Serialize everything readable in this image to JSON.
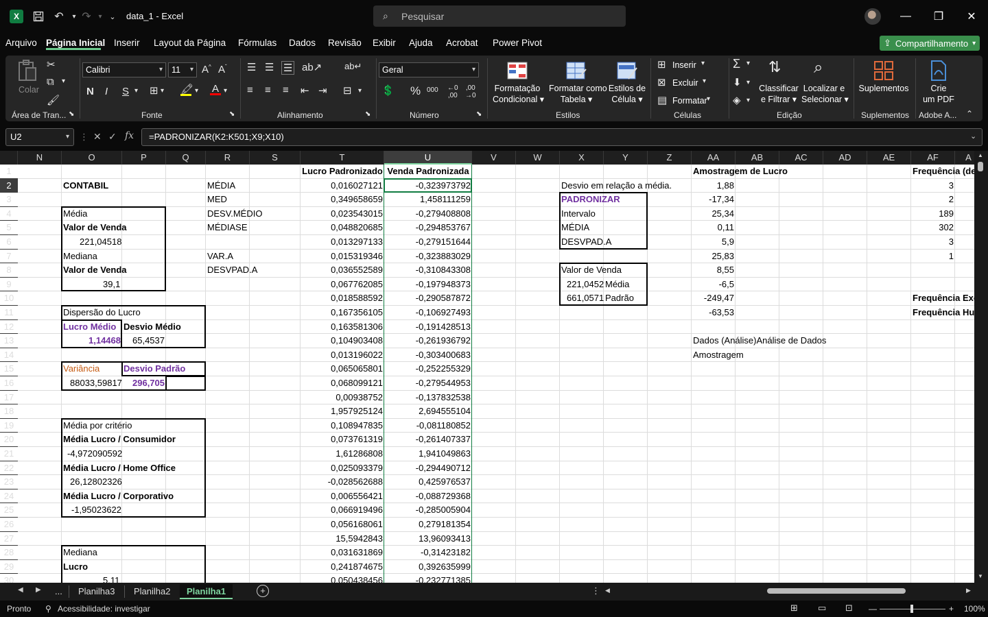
{
  "window": {
    "title": "data_1  -  Excel",
    "search_placeholder": "Pesquisar"
  },
  "menu": {
    "items": [
      "Arquivo",
      "Página Inicial",
      "Inserir",
      "Layout da Página",
      "Fórmulas",
      "Dados",
      "Revisão",
      "Exibir",
      "Ajuda",
      "Acrobat",
      "Power Pivot"
    ],
    "active": "Página Inicial",
    "share_label": "Compartilhamento"
  },
  "ribbon": {
    "clipboard": {
      "paste": "Colar",
      "label": "Área de Tran..."
    },
    "font": {
      "name": "Calibri",
      "size": "11",
      "label": "Fonte"
    },
    "alignment": {
      "label": "Alinhamento"
    },
    "number": {
      "format": "Geral",
      "label": "Número"
    },
    "styles": {
      "cond_format_1": "Formatação",
      "cond_format_2": "Condicional",
      "table_1": "Formatar como",
      "table_2": "Tabela",
      "cell_styles_1": "Estilos de",
      "cell_styles_2": "Célula",
      "label": "Estilos"
    },
    "cells": {
      "insert": "Inserir",
      "delete": "Excluir",
      "format": "Formatar",
      "label": "Células"
    },
    "editing": {
      "sort_1": "Classificar",
      "sort_2": "e Filtrar",
      "find_1": "Localizar e",
      "find_2": "Selecionar",
      "label": "Edição"
    },
    "addins": {
      "btn": "Suplementos",
      "label": "Suplementos"
    },
    "adobe": {
      "btn_1": "Crie",
      "btn_2": "um PDF",
      "label": "Adobe A..."
    }
  },
  "formula_bar": {
    "cell_ref": "U2",
    "formula": "=PADRONIZAR(K2:K501;X9;X10)"
  },
  "columns": [
    "N",
    "O",
    "P",
    "Q",
    "R",
    "S",
    "T",
    "U",
    "V",
    "W",
    "X",
    "Y",
    "Z",
    "AA",
    "AB",
    "AC",
    "AD",
    "AE",
    "AF",
    "A"
  ],
  "selected_column": "U",
  "selected_row": "2",
  "rows": [
    "1",
    "2",
    "3",
    "4",
    "5",
    "6",
    "7",
    "8",
    "9",
    "10",
    "11",
    "12",
    "13",
    "14",
    "15",
    "16",
    "17",
    "18",
    "19",
    "20",
    "21",
    "22",
    "23",
    "24",
    "25",
    "26",
    "27",
    "28",
    "29",
    "30"
  ],
  "cells": {
    "O": {
      "2": "CONTABIL",
      "4": "Média",
      "5": "Valor de Venda",
      "6": "221,04518",
      "7": "Mediana",
      "8": "Valor de Venda",
      "9": "39,1",
      "11": "Dispersão do Lucro",
      "12": "Lucro Médio",
      "13": "1,14468",
      "15": "Variância",
      "16": "88033,59817",
      "19": "Média por critério",
      "20": "Média Lucro / Consumidor",
      "21": "-4,972090592",
      "22": "Média Lucro / Home Office",
      "23": "26,12802326",
      "24": "Média Lucro / Corporativo",
      "25": "-1,95023622",
      "28": "Mediana",
      "29": "Lucro",
      "30": "5,11"
    },
    "P": {
      "12": "Desvio Médio",
      "13": "65,4537",
      "15": "Desvio Padrão",
      "16": "296,705"
    },
    "R": {
      "2": "MÉDIA",
      "3": "MED",
      "4": "DESV.MÉDIO",
      "5": "MÉDIASE",
      "7": "VAR.A",
      "8": "DESVPAD.A"
    },
    "T": [
      "Lucro Padronizado",
      "0,016027121",
      "0,349658659",
      "0,023543015",
      "0,048820685",
      "0,013297133",
      "0,015319346",
      "0,036552589",
      "0,067762085",
      "0,018588592",
      "0,167356105",
      "0,163581306",
      "0,104903408",
      "0,013196022",
      "0,065065801",
      "0,068099121",
      "0,00938752",
      "1,957925124",
      "0,108947835",
      "0,073761319",
      "1,61286808",
      "0,025093379",
      "-0,028562688",
      "0,006556421",
      "0,066919496",
      "0,056168061",
      "15,5942843",
      "0,031631869",
      "0,241874675",
      "0,050438456"
    ],
    "U": [
      "Venda Padronizada",
      "-0,323973792",
      "1,458111259",
      "-0,279408808",
      "-0,294853767",
      "-0,279151644",
      "-0,323883029",
      "-0,310843308",
      "-0,197948373",
      "-0,290587872",
      "-0,106927493",
      "-0,191428513",
      "-0,261936792",
      "-0,303400683",
      "-0,252255329",
      "-0,279544953",
      "-0,137832538",
      "2,694555104",
      "-0,081180852",
      "-0,261407337",
      "1,941049863",
      "-0,294490712",
      "0,425976537",
      "-0,088729368",
      "-0,285005904",
      "0,279181354",
      "13,96093413",
      "-0,31423182",
      "0,392635999",
      "-0,232771385"
    ],
    "X": {
      "2": "Desvio em relação a média.",
      "3": "PADRONIZAR",
      "4": "Intervalo",
      "5": "MÉDIA",
      "6": "DESVPAD.A",
      "8": "Valor de Venda",
      "9": "221,0452",
      "10": "661,0571"
    },
    "Y": {
      "9": "Média",
      "10": "Padrão"
    },
    "AA": {
      "1": "Amostragem de Lucro",
      "2": "1,88",
      "3": "-17,34",
      "4": "25,34",
      "5": "0,11",
      "6": "5,9",
      "7": "25,83",
      "8": "8,55",
      "9": "-6,5",
      "10": "-249,47",
      "11": "-63,53",
      "13": "Dados (Análise)Análise de Dados",
      "14": "Amostragem"
    },
    "AF": {
      "1": "Frequência (de",
      "2": "3",
      "3": "2",
      "4": "189",
      "5": "302",
      "6": "3",
      "7": "1",
      "10": "Frequência Exc",
      "11": "Frequência Hu"
    }
  },
  "sheets": {
    "tabs": [
      "Planilha3",
      "Planilha2",
      "Planilha1"
    ],
    "active": "Planilha1",
    "more": "..."
  },
  "status": {
    "ready": "Pronto",
    "accessibility": "Acessibilidade: investigar",
    "zoom": "100%"
  },
  "colors": {
    "accent_green": "#107c41",
    "purple": "#7030a0",
    "orange": "#c55a11"
  }
}
